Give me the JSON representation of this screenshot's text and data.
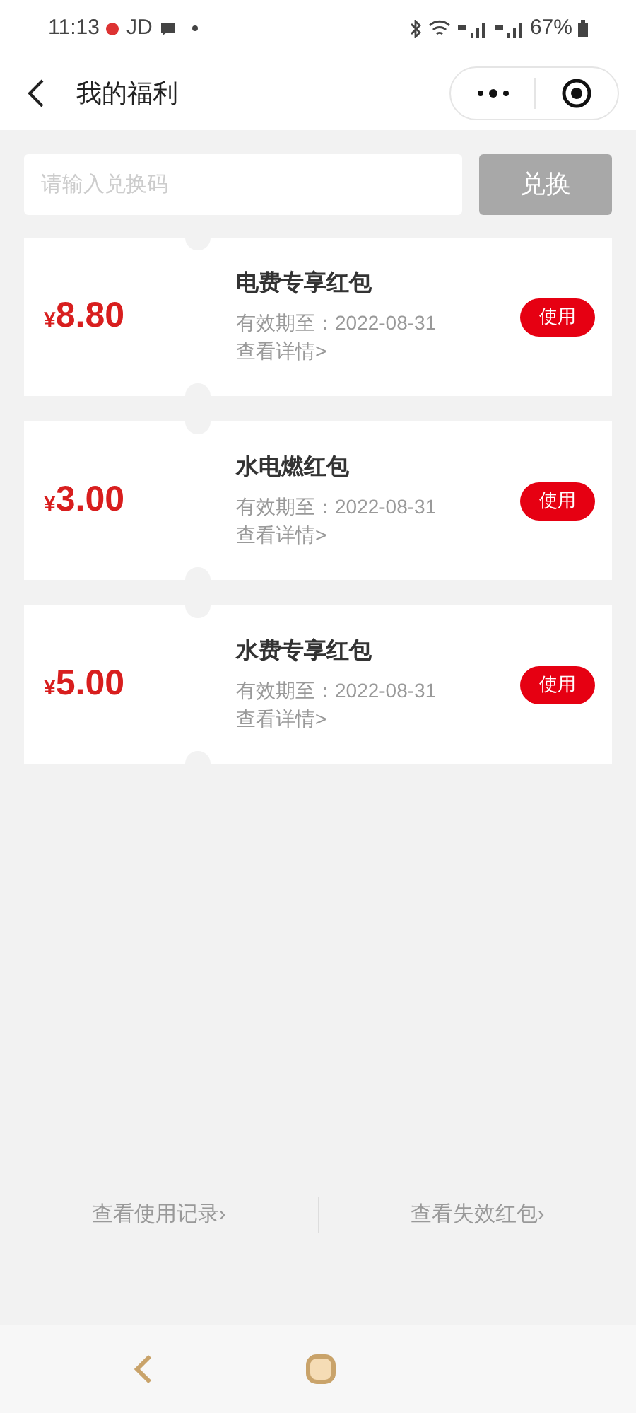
{
  "status_bar": {
    "time": "11:13",
    "carrier": "JD",
    "battery": "67%"
  },
  "header": {
    "title": "我的福利"
  },
  "redeem": {
    "placeholder": "请输入兑换码",
    "button": "兑换",
    "disabled": true
  },
  "coupons": [
    {
      "currency": "¥",
      "amount": "8.80",
      "name": "电费专享红包",
      "expiry": "有效期至：2022-08-31",
      "details": "查看详情>",
      "action": "使用"
    },
    {
      "currency": "¥",
      "amount": "3.00",
      "name": "水电燃红包",
      "expiry": "有效期至：2022-08-31",
      "details": "查看详情>",
      "action": "使用"
    },
    {
      "currency": "¥",
      "amount": "5.00",
      "name": "水费专享红包",
      "expiry": "有效期至：2022-08-31",
      "details": "查看详情>",
      "action": "使用"
    }
  ],
  "footer_links": [
    "查看使用记录›",
    "查看失效红包›"
  ]
}
